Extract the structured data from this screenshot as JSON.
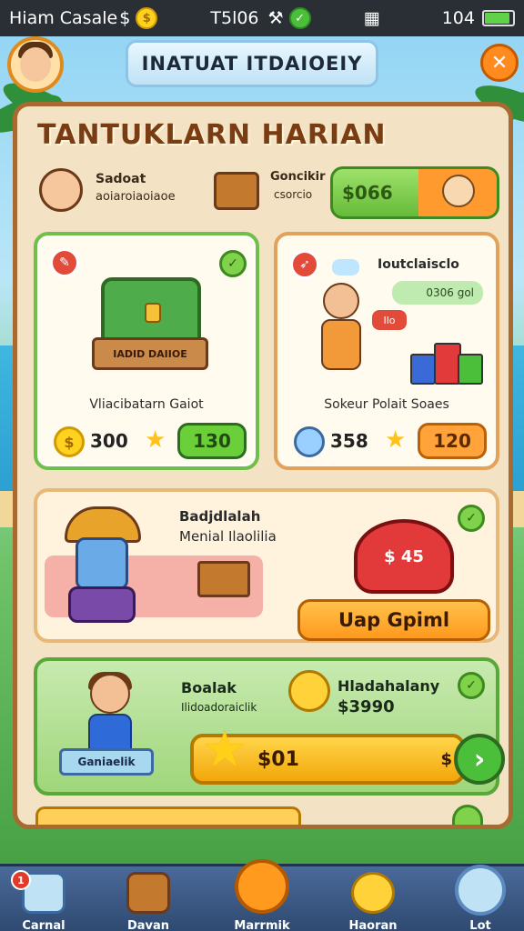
{
  "status_bar": {
    "carrier": "Hiam Casale",
    "carrier_suffix": "$",
    "time": "T5l06",
    "battery_text": "104",
    "battery_level": 0.85
  },
  "header": {
    "title": "INATUAT ITDAIOEIY",
    "close_symbol": "✕"
  },
  "panel": {
    "heading": "TANTUKLARN HARIAN",
    "row1": {
      "name": "Sadoat",
      "subtitle": "aoiaroiaoiaoe",
      "item_label": "Goncikir",
      "item_sub": "csorcio",
      "price": "$066"
    },
    "card_a": {
      "plank_text": "IADID DAIIOE",
      "label": "Vliacibatarn Gaiot",
      "cost": "300",
      "button": "130"
    },
    "card_b": {
      "title": "Ioutclaisclo",
      "gem_text": "0306 gol",
      "bubble": "Ilo",
      "label": "Sokeur Polait Soaes",
      "cost": "358",
      "button": "120"
    },
    "wide_card": {
      "line1": "Badjdlalah",
      "line2": "Menial Ilaolilia",
      "bag_text": "$ 45",
      "button": "Uap Gpiml"
    },
    "green_card": {
      "line1": "Boalak",
      "line2": "Ilidoadoraiclik",
      "reward_title": "Hladahalany",
      "reward_value": "$3990",
      "scroll_text": "Ganiaelik",
      "amount": "$01",
      "amount_sym": "$",
      "next_symbol": "›"
    }
  },
  "nav": {
    "items": [
      {
        "label": "Carnal"
      },
      {
        "label": "Davan"
      },
      {
        "label": "Marrmik"
      },
      {
        "label": "Haoran"
      },
      {
        "label": "Lot"
      }
    ],
    "badge": "1"
  },
  "colors": {
    "panel_border": "#a96a32",
    "accent_orange": "#ff9a1e",
    "accent_green": "#4cbf3a"
  }
}
